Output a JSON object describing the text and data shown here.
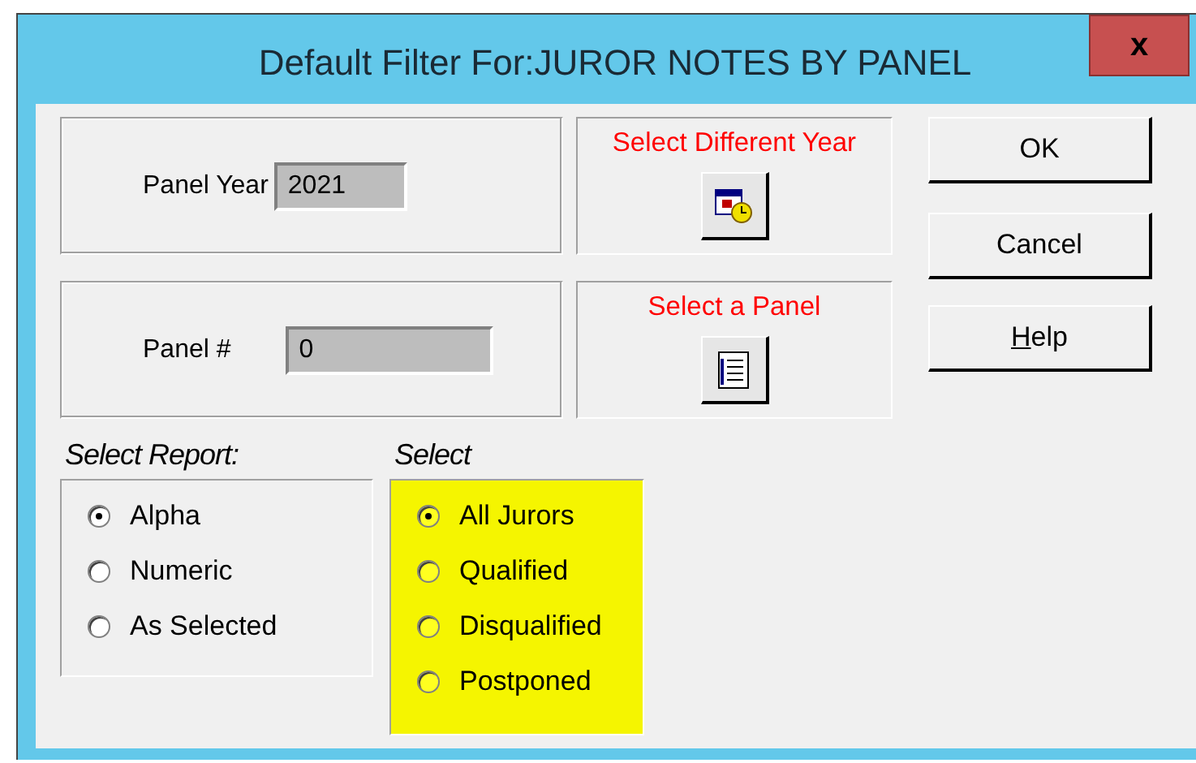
{
  "window": {
    "title": "Default Filter For:JUROR NOTES BY PANEL",
    "close": "x"
  },
  "fields": [
    {
      "label": "Panel Year",
      "value": "2021",
      "action": "Select Different Year"
    },
    {
      "label": "Panel #",
      "value": "0",
      "action": "Select a Panel"
    }
  ],
  "buttons": [
    "OK",
    "Cancel",
    "Help"
  ],
  "groups": [
    {
      "title": "Select Report:",
      "highlighted": false,
      "options": [
        {
          "label": "Alpha",
          "selected": true
        },
        {
          "label": "Numeric",
          "selected": false
        },
        {
          "label": "As Selected",
          "selected": false
        }
      ]
    },
    {
      "title": "Select",
      "highlighted": true,
      "options": [
        {
          "label": "All Jurors",
          "selected": true
        },
        {
          "label": "Qualified",
          "selected": false
        },
        {
          "label": "Disqualified",
          "selected": false
        },
        {
          "label": "Postponed",
          "selected": false
        }
      ]
    }
  ]
}
